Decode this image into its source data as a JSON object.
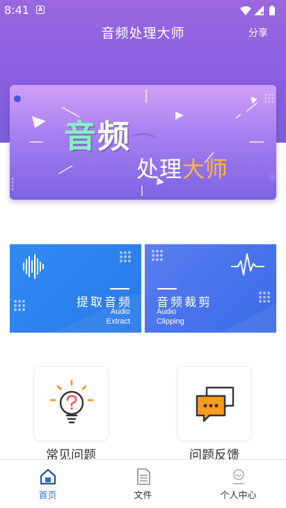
{
  "status_bar": {
    "time": "8:41",
    "app_badge": "A"
  },
  "header": {
    "title": "音频处理大师",
    "share_label": "分享"
  },
  "banner": {
    "line1_part1": "音",
    "line1_part2": "频",
    "line2_part1": "处理",
    "line2_part2": "大师"
  },
  "features": [
    {
      "title": "提取音频",
      "subtitle_line1": "Audio",
      "subtitle_line2": "Extract",
      "icon": "waveform-icon"
    },
    {
      "title": "音频裁剪",
      "subtitle_line1": "Audio",
      "subtitle_line2": "Clipping",
      "icon": "pulse-icon"
    }
  ],
  "help": [
    {
      "label": "常见问题",
      "icon": "question-bulb-icon"
    },
    {
      "label": "问题反馈",
      "icon": "chat-bubbles-icon"
    }
  ],
  "nav": [
    {
      "label": "首页",
      "icon": "home-icon",
      "active": true
    },
    {
      "label": "文件",
      "icon": "file-icon",
      "active": false
    },
    {
      "label": "个人中心",
      "icon": "user-icon",
      "active": false
    }
  ],
  "colors": {
    "header_purple": "#8a5fe0",
    "extract_blue": "#2f8bf2",
    "clip_blue": "#4a73ea",
    "active_nav": "#2b6fd6",
    "banner_orange": "#ffb43a",
    "banner_mint": "#86f0c0"
  }
}
